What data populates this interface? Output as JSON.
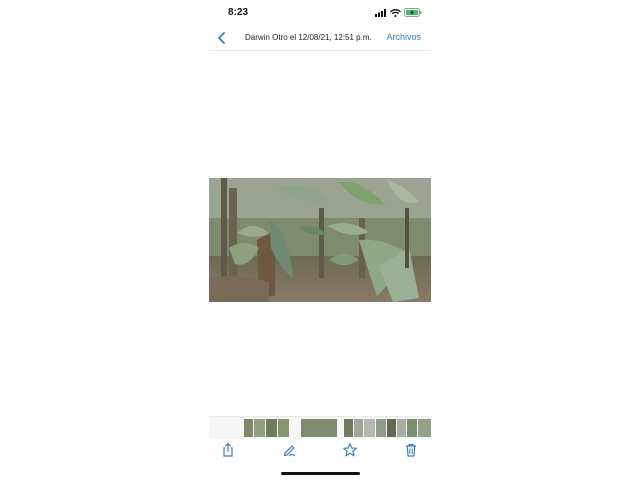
{
  "status_bar": {
    "time": "8:23",
    "icons": [
      "signal-icon",
      "wifi-icon",
      "battery-charging-icon"
    ],
    "battery_color": "#34c759"
  },
  "nav_bar": {
    "back_icon": "chevron-left-icon",
    "title": "Darwin Otro el 12/08/21, 12:51 p.m.",
    "action_label": "Archivos",
    "accent_color": "#2f7fd6"
  },
  "photo": {
    "subject": "banana-plants-photo"
  },
  "thumbnail_strip": {
    "count": 13,
    "selected_index": 4
  },
  "toolbar": {
    "items": [
      "share-icon",
      "markup-icon",
      "favorite-star-icon",
      "trash-icon"
    ]
  }
}
